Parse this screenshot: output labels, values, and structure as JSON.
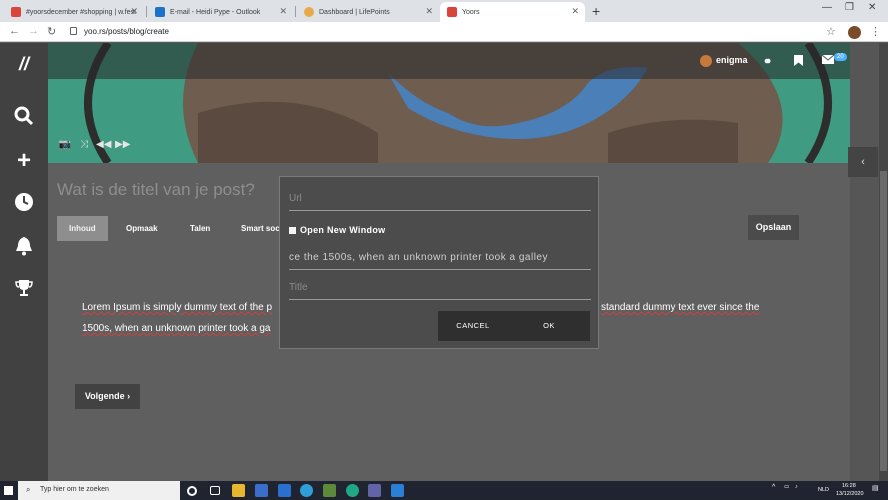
{
  "browser": {
    "tabs": [
      {
        "title": "#yoorsdecember #shopping | w.fest",
        "active": false
      },
      {
        "title": "E-mail - Heidi Pype - Outlook",
        "active": false
      },
      {
        "title": "Dashboard | LifePoints",
        "active": false
      },
      {
        "title": "Yoors",
        "active": true
      }
    ],
    "new_tab_label": "+",
    "url": "yoo.rs/posts/blog/create"
  },
  "header": {
    "username": "enigma",
    "notification_count": "20"
  },
  "editor": {
    "title_placeholder": "Wat is de titel van je post?",
    "tabs": [
      "Inhoud",
      "Opmaak",
      "Talen",
      "Smart soci"
    ],
    "save_label": "Opslaan",
    "body_line1_left": "Lorem Ipsum is simply dummy text of the p",
    "body_line1_right": "standard dummy text ever since the",
    "body_line2": "1500s, when an unknown printer took a ga",
    "next_label": "Volgende"
  },
  "modal": {
    "url_placeholder": "Url",
    "open_new_window_label": "Open New Window",
    "text_value": "ce the 1500s, when an unknown printer took a galley",
    "title_placeholder": "Title",
    "cancel_label": "CANCEL",
    "ok_label": "OK"
  },
  "taskbar": {
    "search_placeholder": "Typ hier om te zoeken",
    "lang": "NLD",
    "time": "16:28",
    "date": "13/12/2020"
  },
  "colors": {
    "accent": "#4fb0ff",
    "overlay": "#5f5f5f",
    "modal_bg": "#4c4c4c"
  }
}
